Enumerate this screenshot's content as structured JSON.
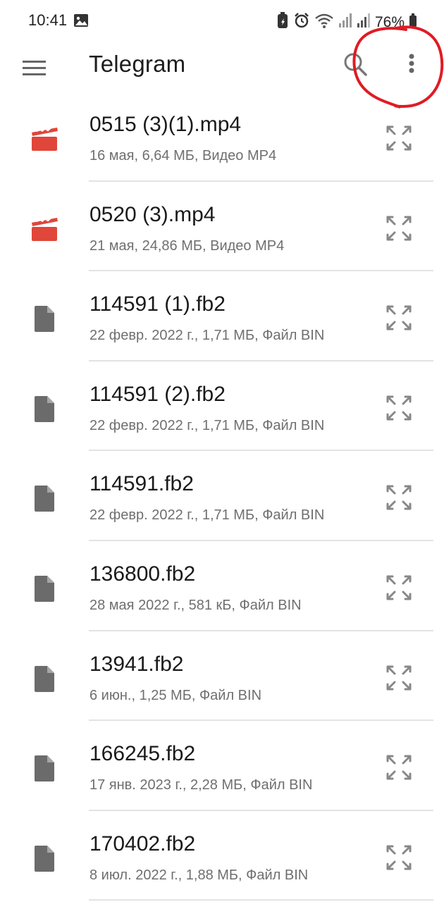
{
  "status_bar": {
    "time": "10:41",
    "battery": "76%"
  },
  "app_bar": {
    "title": "Telegram",
    "icons": [
      "menu-icon",
      "search-icon",
      "more-vert-icon"
    ]
  },
  "colors": {
    "video_icon": "#e0463a",
    "doc_icon": "#6b6b6b",
    "annotation": "#e01b24"
  },
  "files": [
    {
      "name": "0515 (3)(1).mp4",
      "meta": "16 мая, 6,64 МБ, Видео MP4",
      "icon": "video-clapper-icon"
    },
    {
      "name": "0520 (3).mp4",
      "meta": "21 мая, 24,86 МБ, Видео MP4",
      "icon": "video-clapper-icon"
    },
    {
      "name": "114591 (1).fb2",
      "meta": "22 февр. 2022 г., 1,71 МБ, Файл BIN",
      "icon": "document-icon"
    },
    {
      "name": "114591 (2).fb2",
      "meta": "22 февр. 2022 г., 1,71 МБ, Файл BIN",
      "icon": "document-icon"
    },
    {
      "name": "114591.fb2",
      "meta": "22 февр. 2022 г., 1,71 МБ, Файл BIN",
      "icon": "document-icon"
    },
    {
      "name": "136800.fb2",
      "meta": "28 мая 2022 г., 581 кБ, Файл BIN",
      "icon": "document-icon"
    },
    {
      "name": "13941.fb2",
      "meta": "6 июн., 1,25 МБ, Файл BIN",
      "icon": "document-icon"
    },
    {
      "name": "166245.fb2",
      "meta": "17 янв. 2023 г., 2,28 МБ, Файл BIN",
      "icon": "document-icon"
    },
    {
      "name": "170402.fb2",
      "meta": "8 июл. 2022 г., 1,88 МБ, Файл BIN",
      "icon": "document-icon"
    }
  ]
}
